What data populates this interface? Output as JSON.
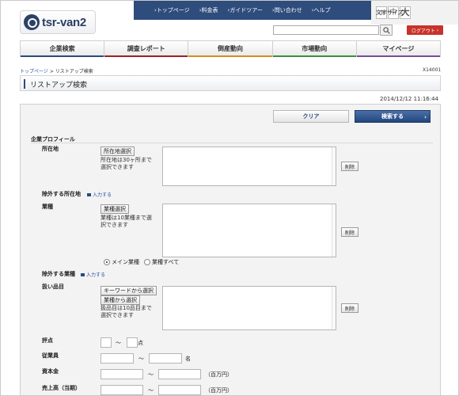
{
  "header": {
    "logo_text": "tsr-van2",
    "top_links": [
      "トップページ",
      "料金表",
      "ガイドツアー",
      "問い合わせ",
      "ヘルプ"
    ],
    "font_size_label": "文字サイズ",
    "font_sizes": [
      "小",
      "中",
      "大"
    ],
    "search_placeholder": "",
    "logout_label": "ログアウト"
  },
  "main_nav": [
    {
      "label": "企業検索",
      "color": "#2b4a80"
    },
    {
      "label": "調査レポート",
      "color": "#9a2323"
    },
    {
      "label": "倒産動向",
      "color": "#d98c1f"
    },
    {
      "label": "市場動向",
      "color": "#3d8f3d"
    },
    {
      "label": "マイページ",
      "color": "#7a4a9a"
    }
  ],
  "breadcrumb": {
    "home": "トップページ",
    "separator": ">",
    "current": "リストアップ検索"
  },
  "screen_code": "X14001",
  "page_title": "リストアップ検索",
  "timestamp": "2014/12/12 11:16:44",
  "actions": {
    "clear": "クリア",
    "search": "検索する"
  },
  "form": {
    "section_title": "企業プロフィール",
    "location": {
      "label": "所在地",
      "button": "所在地選択",
      "hint": [
        "所在地は30ヶ所まで",
        "選択できます"
      ],
      "delete": "削除"
    },
    "exclude_location": {
      "label": "除外する所在地",
      "link": "入力する"
    },
    "industry": {
      "label": "業種",
      "button": "業種選択",
      "hint": [
        "業種は10業種まで選",
        "択できます"
      ],
      "delete": "削除",
      "radio_main": "メイン業種",
      "radio_all": "業種すべて"
    },
    "exclude_industry": {
      "label": "除外する業種",
      "link": "入力する"
    },
    "products": {
      "label": "扱い品目",
      "button_keyword": "キーワードから選択",
      "button_industry": "業種から選択",
      "hint": [
        "扱品目は10品目まで",
        "選択できます"
      ],
      "delete": "削除"
    },
    "rating": {
      "label": "評点",
      "tilde": "〜",
      "unit": "点"
    },
    "employees": {
      "label": "従業員",
      "tilde": "〜",
      "unit": "名"
    },
    "capital": {
      "label": "資本金",
      "tilde": "〜",
      "unit": "（百万円）"
    },
    "sales": {
      "label": "売上高（当期）",
      "tilde": "〜",
      "unit": "（百万円）"
    }
  }
}
